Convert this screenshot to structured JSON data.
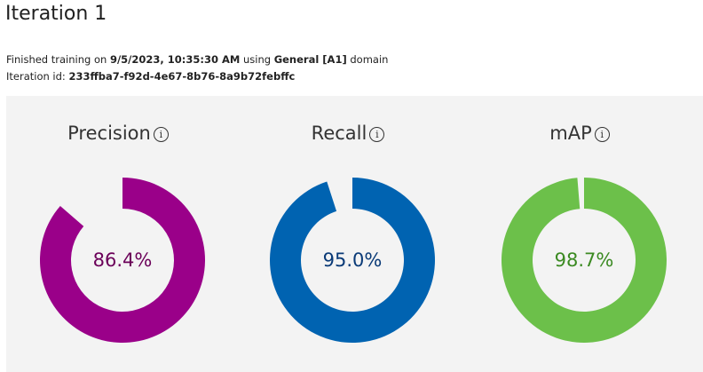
{
  "header": {
    "title": "Iteration 1"
  },
  "training": {
    "prefix": "Finished training on ",
    "timestamp": "9/5/2023, 10:35:30 AM",
    "middle": " using ",
    "domain": "General [A1]",
    "suffix": " domain"
  },
  "iteration": {
    "id_label": "Iteration id: ",
    "id_value": "233ffba7-f92d-4e67-8b76-8a9b72febffc"
  },
  "metrics": [
    {
      "label": "Precision",
      "value_text": "86.4%",
      "value": 0.864,
      "ring_color": "#9a0089",
      "text_color": "#6b0059",
      "icon": "info-icon"
    },
    {
      "label": "Recall",
      "value_text": "95.0%",
      "value": 0.95,
      "ring_color": "#0063b1",
      "text_color": "#0a3a77",
      "icon": "info-icon"
    },
    {
      "label": "mAP",
      "value_text": "98.7%",
      "value": 0.987,
      "ring_color": "#6cc04a",
      "text_color": "#3b8a22",
      "icon": "info-icon"
    }
  ],
  "panel": {
    "background": "#f3f3f3"
  }
}
